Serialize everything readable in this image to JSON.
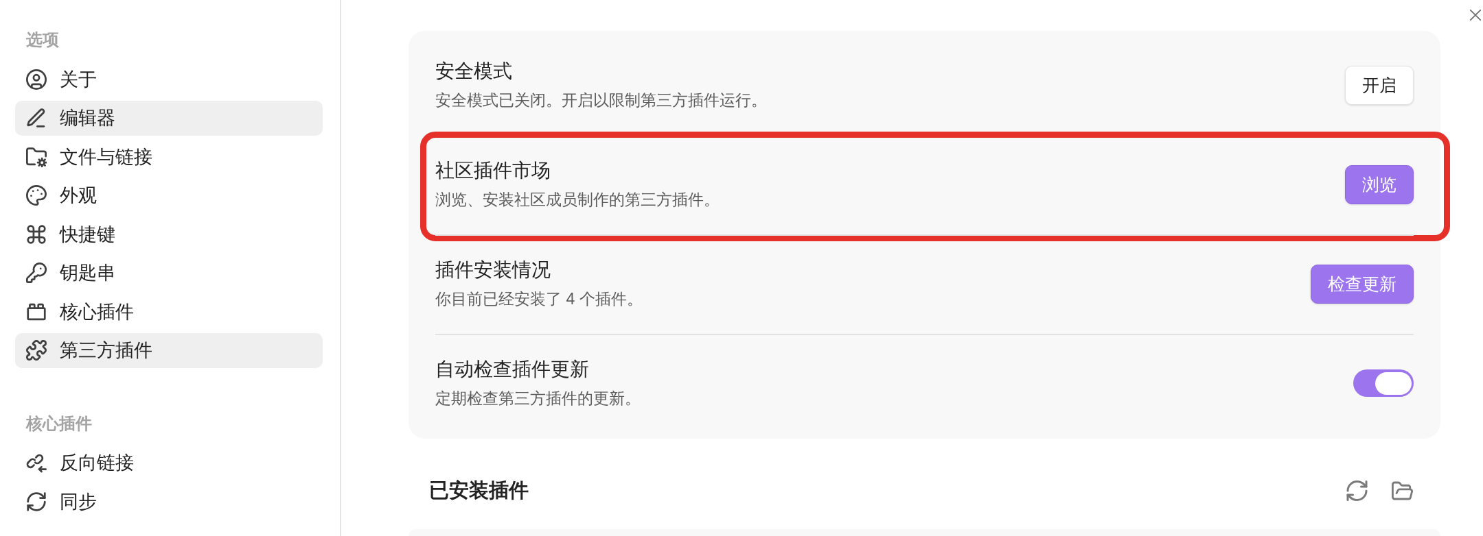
{
  "sidebar": {
    "sections": [
      {
        "heading": "选项",
        "items": [
          {
            "label": "关于",
            "selected": false
          },
          {
            "label": "编辑器",
            "selected": true
          },
          {
            "label": "文件与链接",
            "selected": false
          },
          {
            "label": "外观",
            "selected": false
          },
          {
            "label": "快捷键",
            "selected": false
          },
          {
            "label": "钥匙串",
            "selected": false
          },
          {
            "label": "核心插件",
            "selected": false
          },
          {
            "label": "第三方插件",
            "selected": true
          }
        ]
      },
      {
        "heading": "核心插件",
        "items": [
          {
            "label": "反向链接",
            "selected": false
          },
          {
            "label": "同步",
            "selected": false
          }
        ]
      }
    ]
  },
  "settings": [
    {
      "title": "安全模式",
      "description": "安全模式已关闭。开启以限制第三方插件运行。",
      "highlighted": false,
      "control": {
        "kind": "button",
        "label": "开启",
        "primary": false
      }
    },
    {
      "title": "社区插件市场",
      "description": "浏览、安装社区成员制作的第三方插件。",
      "highlighted": true,
      "control": {
        "kind": "button",
        "label": "浏览",
        "primary": true
      }
    },
    {
      "title": "插件安装情况",
      "description": "你目前已经安装了 4 个插件。",
      "highlighted": false,
      "control": {
        "kind": "button",
        "label": "检查更新",
        "primary": true
      }
    },
    {
      "title": "自动检查插件更新",
      "description": "定期检查第三方插件的更新。",
      "highlighted": false,
      "control": {
        "kind": "toggle",
        "on": true
      }
    }
  ],
  "installed_plugins": {
    "heading": "已安装插件"
  }
}
